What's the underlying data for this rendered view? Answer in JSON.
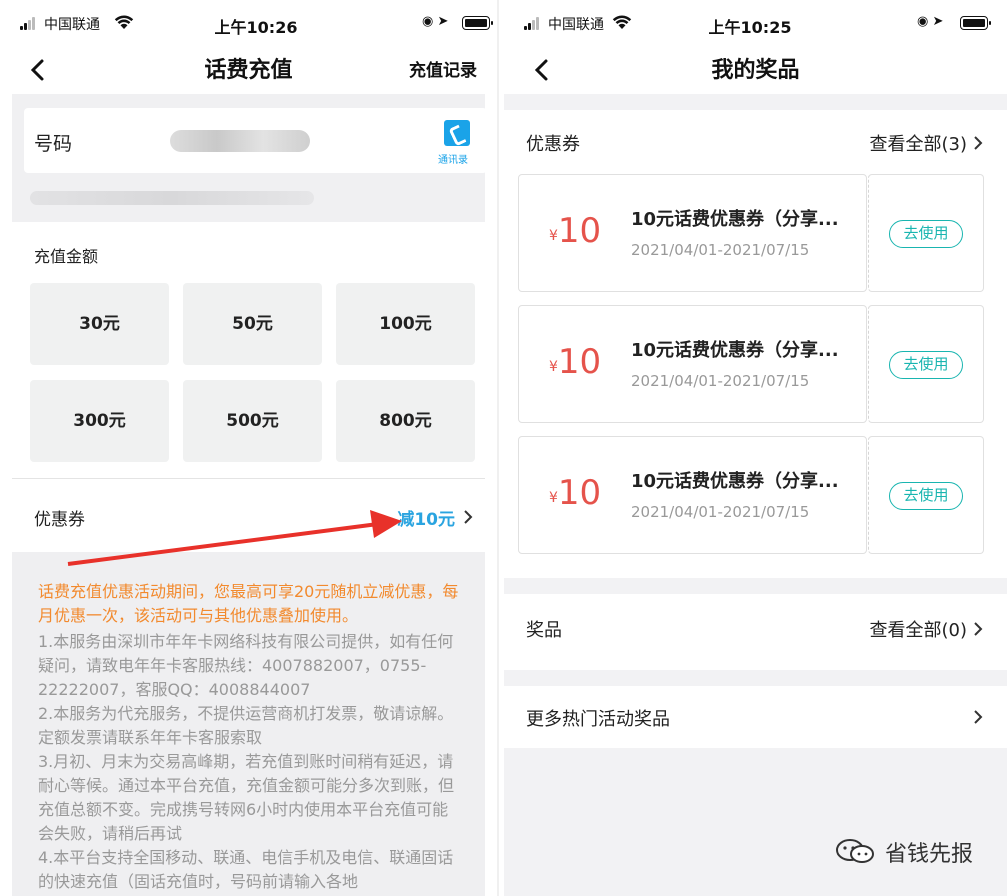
{
  "left": {
    "status": {
      "carrier": "中国联通",
      "time": "上午10:26"
    },
    "nav": {
      "title": "话费充值",
      "right_action": "充值记录"
    },
    "phone_field": {
      "label": "号码",
      "contacts_label": "通讯录"
    },
    "amount_section": {
      "title": "充值金额",
      "options": [
        "30元",
        "50元",
        "100元",
        "300元",
        "500元",
        "800元"
      ]
    },
    "coupon_row": {
      "label": "优惠券",
      "value": "减10元"
    },
    "notes": {
      "promo": "话费充值优惠活动期间，您最高可享20元随机立减优惠，每月优惠一次，该活动可与其他优惠叠加使用。",
      "items": [
        "1.本服务由深圳市年年卡网络科技有限公司提供，如有任何疑问，请致电年年卡客服热线：4007882007，0755-22222007，客服QQ：4008844007",
        "2.本服务为代充服务，不提供运营商机打发票，敬请谅解。定额发票请联系年年卡客服索取",
        "3.月初、月末为交易高峰期，若充值到账时间稍有延迟，请耐心等候。通过本平台充值，充值金额可能分多次到账，但充值总额不变。完成携号转网6小时内使用本平台充值可能会失败，请稍后再试",
        "4.本平台支持全国移动、联通、电信手机及电信、联通固话的快速充值（固话充值时，号码前请输入各地"
      ]
    }
  },
  "right": {
    "status": {
      "carrier": "中国联通",
      "time": "上午10:25"
    },
    "nav": {
      "title": "我的奖品"
    },
    "coupons_header": {
      "label": "优惠券",
      "view_all": "查看全部(3)"
    },
    "coupons": [
      {
        "currency": "¥",
        "amount": "10",
        "title": "10元话费优惠券（分享...",
        "date": "2021/04/01-2021/07/15",
        "action": "去使用"
      },
      {
        "currency": "¥",
        "amount": "10",
        "title": "10元话费优惠券（分享...",
        "date": "2021/04/01-2021/07/15",
        "action": "去使用"
      },
      {
        "currency": "¥",
        "amount": "10",
        "title": "10元话费优惠券（分享...",
        "date": "2021/04/01-2021/07/15",
        "action": "去使用"
      }
    ],
    "prizes_row": {
      "label": "奖品",
      "view_all": "查看全部(0)"
    },
    "more_row": {
      "label": "更多热门活动奖品"
    }
  },
  "watermark": {
    "text": "省钱先报",
    "icon": "wechat-icon"
  },
  "colors": {
    "accent_blue": "#2aa4e0",
    "promo_orange": "#f28a2e",
    "coupon_red": "#e5534b",
    "use_teal": "#19b5b0",
    "arrow_red": "#e8312a"
  }
}
